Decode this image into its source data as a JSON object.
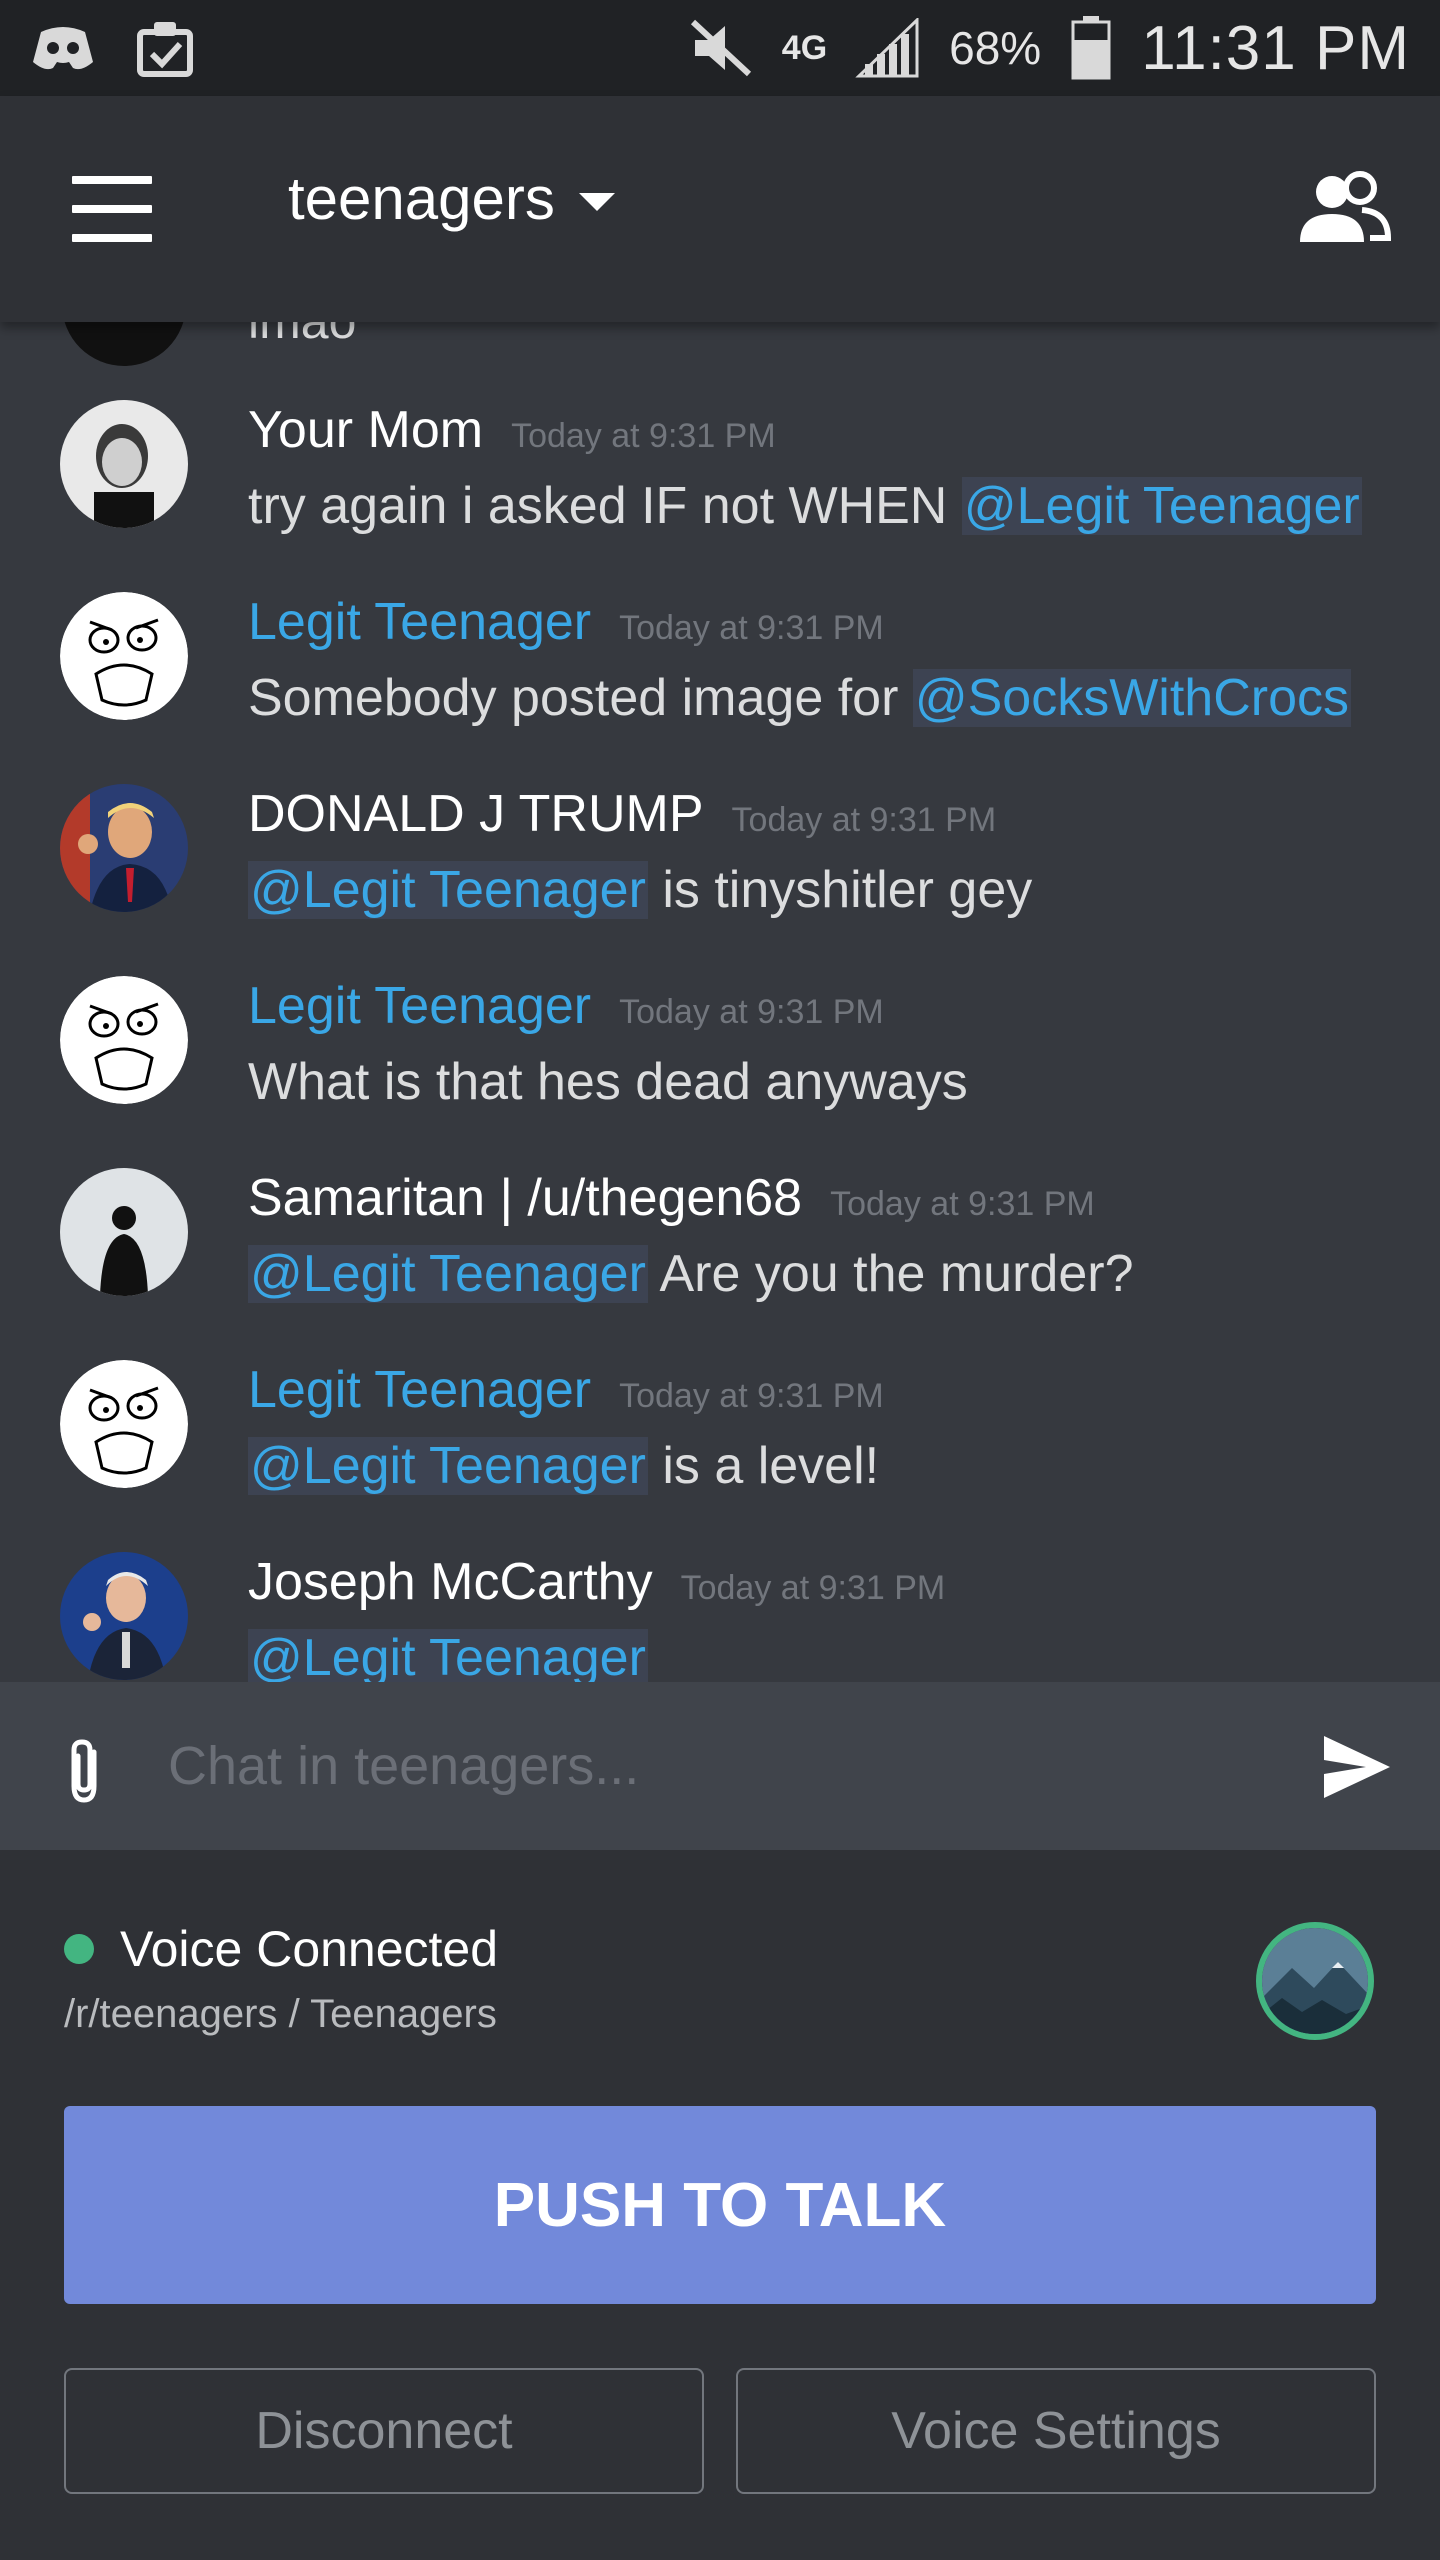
{
  "status_bar": {
    "icons": [
      "discord-icon",
      "clipboard-check-icon",
      "mute-icon",
      "signal-icon",
      "battery-icon"
    ],
    "network": "4G",
    "battery": "68%",
    "time": "11:31 PM"
  },
  "header": {
    "channel": "teenagers"
  },
  "messages": {
    "partial_text": "lmao",
    "items": [
      {
        "author": "Your Mom",
        "time": "Today at 9:31 PM",
        "pre": "try again  i asked IF not WHEN ",
        "mention": "@Legit Teenager",
        "post": "",
        "author_color": "#ffffff"
      },
      {
        "author": "Legit Teenager",
        "time": "Today at 9:31 PM",
        "pre": "Somebody posted image for ",
        "mention": "@SocksWithCrocs",
        "post": "",
        "author_color": "#3aa7e6"
      },
      {
        "author": "DONALD J TRUMP",
        "time": "Today at 9:31 PM",
        "pre": "",
        "mention": "@Legit Teenager",
        "post": " is tinyshitler gey",
        "author_color": "#ffffff"
      },
      {
        "author": "Legit Teenager",
        "time": "Today at 9:31 PM",
        "pre": "What is that hes dead anyways",
        "mention": "",
        "post": "",
        "author_color": "#3aa7e6"
      },
      {
        "author": "Samaritan  | /u/thegen68",
        "time": "Today at 9:31 PM",
        "pre": "",
        "mention": "@Legit Teenager",
        "post": " Are you the murder?",
        "author_color": "#ffffff"
      },
      {
        "author": "Legit Teenager",
        "time": "Today at 9:31 PM",
        "pre": "",
        "mention": "@Legit Teenager",
        "post": " is a level!",
        "author_color": "#3aa7e6"
      },
      {
        "author": "Joseph McCarthy",
        "time": "Today at 9:31 PM",
        "pre": "",
        "mention": "@Legit Teenager",
        "post": "",
        "author_color": "#ffffff"
      }
    ]
  },
  "composer": {
    "placeholder": "Chat in teenagers..."
  },
  "voice": {
    "status": "Voice Connected",
    "channel_path": "/r/teenagers / Teenagers",
    "push_to_talk": "PUSH TO TALK",
    "disconnect": "Disconnect",
    "settings": "Voice Settings",
    "status_color": "#43b581",
    "accent_color": "#7289da"
  }
}
